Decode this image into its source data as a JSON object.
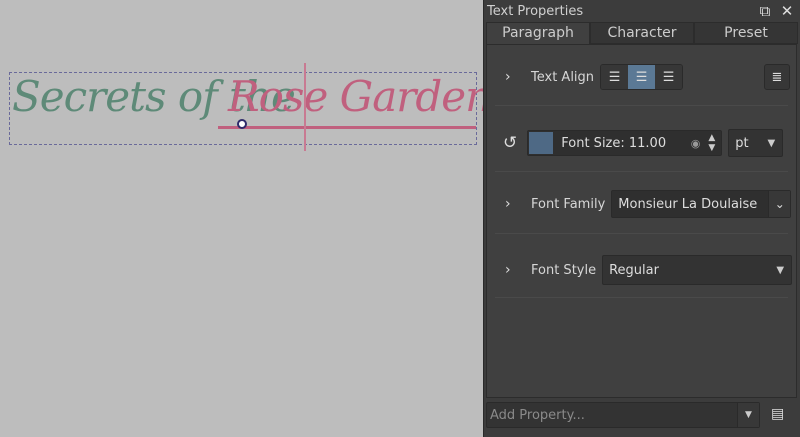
{
  "canvas": {
    "text_part1": "Secrets of the",
    "text_part2": "Rose Garden",
    "color_part1": "#5e8a78",
    "color_part2": "#c0607e"
  },
  "panel": {
    "title": "Text Properties",
    "icons": {
      "float": "float-window-icon",
      "close": "close-icon"
    },
    "tabs": [
      {
        "label": "Paragraph",
        "active": true
      },
      {
        "label": "Character",
        "active": false
      },
      {
        "label": "Preset",
        "active": false
      }
    ],
    "text_align": {
      "label": "Text Align",
      "options": [
        "align-left",
        "align-center",
        "align-right"
      ],
      "selected": "align-center",
      "justify_icon": "justify-icon"
    },
    "font_size": {
      "label": "Font Size: 11.00",
      "unit": "pt",
      "swatch_color": "#4e6985"
    },
    "font_family": {
      "label": "Font Family",
      "value": "Monsieur La Doulaise"
    },
    "font_style": {
      "label": "Font Style",
      "value": "Regular"
    },
    "add_property": {
      "placeholder": "Add Property..."
    }
  }
}
